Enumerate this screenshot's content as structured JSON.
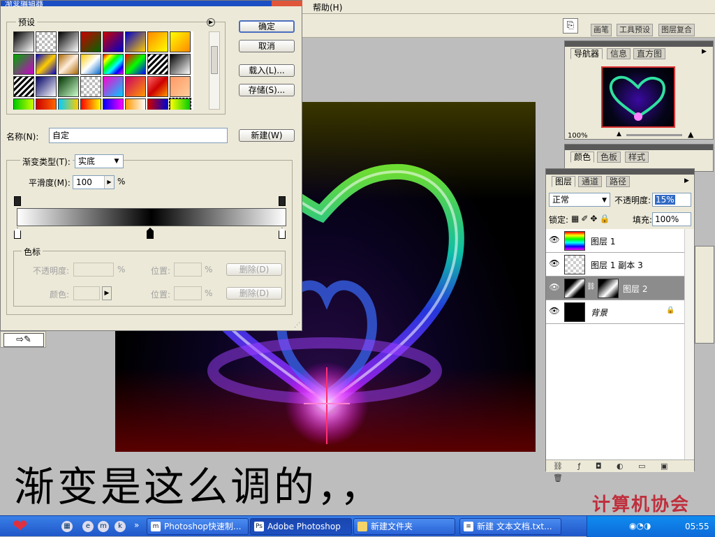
{
  "menubar": {
    "help": "帮助(H)"
  },
  "options_bar": {
    "palette_tabs": [
      "画笔",
      "工具预设",
      "图层复合"
    ]
  },
  "gradient_editor": {
    "title": "渐变编辑器",
    "presets_label": "预设",
    "buttons": {
      "ok": "确定",
      "cancel": "取消",
      "load": "载入(L)...",
      "save": "存储(S)...",
      "new": "新建(W)"
    },
    "name_label": "名称(N):",
    "name_value": "自定",
    "gradient_type_label": "渐变类型(T):",
    "gradient_type_value": "实底",
    "smoothness_label": "平滑度(M):",
    "smoothness_value": "100",
    "smoothness_unit": "%",
    "color_stops": {
      "label": "色标",
      "opacity_label": "不透明度:",
      "location_label": "位置:",
      "color_label": "颜色:",
      "percent": "%",
      "delete": "删除(D)"
    },
    "gradient_stops_colors": [
      "#ffffff",
      "#000000",
      "#ffffff"
    ],
    "preset_swatches": [
      "linear-gradient(135deg,#000,#fff)",
      "repeating-conic-gradient(#bbb 0 25%,#fff 0 50%) 0 0/8px 8px",
      "linear-gradient(135deg,#000,#fff)",
      "linear-gradient(135deg,#c00,#060)",
      "linear-gradient(135deg,#c00,#00c)",
      "linear-gradient(135deg,#00c,#fc0)",
      "linear-gradient(135deg,#f80,#ff0)",
      "linear-gradient(135deg,#ff0,#f80)",
      "linear-gradient(135deg,#0a0,#c0c)",
      "linear-gradient(135deg,#00c,#fc0,#00c)",
      "linear-gradient(135deg,#a60,#fed,#a60)",
      "linear-gradient(135deg,#fc0,#fff,#06c)",
      "linear-gradient(135deg,#f00,#ff0,#0f0,#0ff,#00f,#f0f)",
      "linear-gradient(135deg,#f00,#0f0,#00f)",
      "repeating-linear-gradient(135deg,#000 0 3px,#fff 3px 6px)",
      "linear-gradient(135deg,#000,#fff)",
      "repeating-linear-gradient(135deg,#000 0 3px,#fff 3px 6px)",
      "linear-gradient(135deg,#006,#fff)",
      "linear-gradient(135deg,#030,#cfc)",
      "repeating-conic-gradient(#bbb 0 25%,#fff 0 50%) 0 0/8px 8px",
      "linear-gradient(135deg,#f0c,#0cf)",
      "linear-gradient(135deg,#c06,#f90)",
      "linear-gradient(135deg,#f66,#c00,#f90)",
      "linear-gradient(135deg,#f96,#fc9)",
      "linear-gradient(90deg,#0c0,#cf0)",
      "linear-gradient(90deg,#c00,#f60)",
      "linear-gradient(90deg,#0cf,#fc0)",
      "linear-gradient(90deg,#f00,#ff0)",
      "linear-gradient(90deg,#00f,#f0f)",
      "linear-gradient(90deg,#f90,#fff)",
      "linear-gradient(90deg,#c00,#00c)",
      "linear-gradient(90deg,#ff0,#0c0)"
    ]
  },
  "navigator": {
    "tabs": [
      "导航器",
      "信息",
      "直方图"
    ],
    "zoom": "100%"
  },
  "color_panel": {
    "tabs": [
      "颜色",
      "色板",
      "样式"
    ]
  },
  "layers_panel": {
    "tabs": [
      "图层",
      "通道",
      "路径"
    ],
    "blend_mode": "正常",
    "opacity_label": "不透明度:",
    "opacity_value": "15%",
    "lock_label": "锁定:",
    "fill_label": "填充:",
    "fill_value": "100%",
    "layers": [
      {
        "name": "图层 1",
        "thumb": "linear-gradient(180deg,#f00,#ff0,#0f0,#0ff,#00f,#f0f)"
      },
      {
        "name": "图层 1 副本 3",
        "thumb": "repeating-conic-gradient(#ccc 0 25%,#fff 0 50%) 0 0/8px 8px"
      },
      {
        "name": "图层 2",
        "thumb": "linear-gradient(135deg,#000 30%,#fff 50%,#000 70%)",
        "mask": "linear-gradient(135deg,#000 20%,#fff 60%,#000 90%)"
      },
      {
        "name": "背景",
        "thumb": "#000000"
      }
    ]
  },
  "caption": "渐变是这么调的，，",
  "watermark": "计算机协会",
  "taskbar": {
    "tasks": [
      "Photoshop快速制...",
      "Adobe Photoshop",
      "新建文件夹",
      "新建 文本文档.txt..."
    ],
    "clock": "05:55"
  },
  "colors": {
    "menubar": "#ece9d8",
    "workspace": "#bdbdbd",
    "taskbar": "#245edb",
    "watermark": "#c02030"
  }
}
